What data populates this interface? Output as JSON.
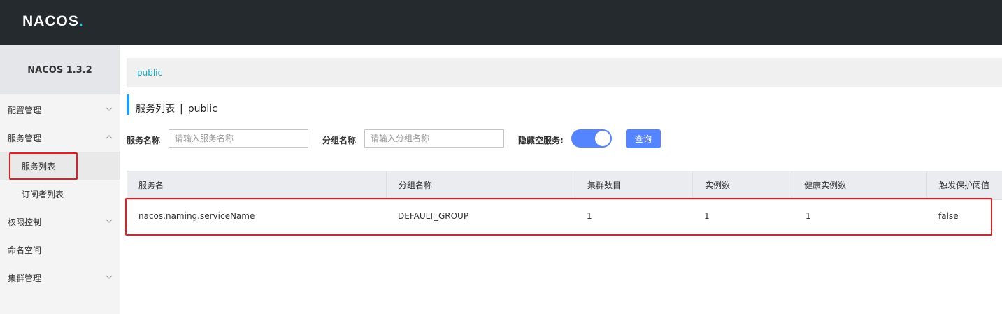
{
  "header": {
    "logo_text": "NACOS",
    "logo_suffix": "."
  },
  "sidebar": {
    "version": "NACOS 1.3.2",
    "items": [
      {
        "label": "配置管理",
        "chevron": "down"
      },
      {
        "label": "服务管理",
        "chevron": "up"
      },
      {
        "label": "服务列表",
        "active": true
      },
      {
        "label": "订阅者列表"
      },
      {
        "label": "权限控制",
        "chevron": "down"
      },
      {
        "label": "命名空间"
      },
      {
        "label": "集群管理",
        "chevron": "down"
      }
    ]
  },
  "main": {
    "namespace_crumb": "public",
    "page_title": "服务列表",
    "title_separator": "|",
    "title_namespace": "public",
    "filters": {
      "service_name_label": "服务名称",
      "service_name_placeholder": "请输入服务名称",
      "group_name_label": "分组名称",
      "group_name_placeholder": "请输入分组名称",
      "hide_empty_label": "隐藏空服务:",
      "hide_empty_enabled": true,
      "query_button": "查询"
    },
    "table": {
      "columns": [
        "服务名",
        "分组名称",
        "集群数目",
        "实例数",
        "健康实例数",
        "触发保护阈值"
      ],
      "rows": [
        [
          "nacos.naming.serviceName",
          "DEFAULT_GROUP",
          "1",
          "1",
          "1",
          "false"
        ]
      ]
    }
  },
  "colors": {
    "topbar": "#252a2f",
    "accent": "#5584ff",
    "link": "#20a7c9",
    "highlight_box": "#e02020"
  }
}
